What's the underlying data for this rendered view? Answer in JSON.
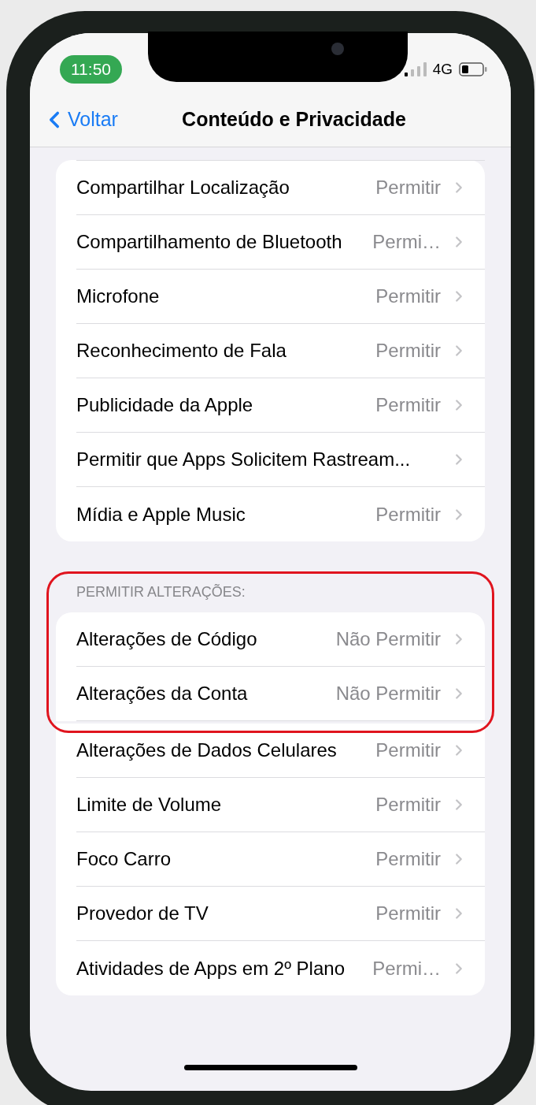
{
  "status_bar": {
    "time": "11:50",
    "network": "4G"
  },
  "nav": {
    "back": "Voltar",
    "title": "Conteúdo e Privacidade"
  },
  "sections": [
    {
      "highlighted": false,
      "rows": [
        {
          "label": "Compartilhar Localização",
          "value": "Permitir"
        },
        {
          "label": "Compartilhamento de Bluetooth",
          "value": "Permi…"
        },
        {
          "label": "Microfone",
          "value": "Permitir"
        },
        {
          "label": "Reconhecimento de Fala",
          "value": "Permitir"
        },
        {
          "label": "Publicidade da Apple",
          "value": "Permitir"
        },
        {
          "label": "Permitir que Apps Solicitem Rastream..."
        },
        {
          "label": "Mídia e Apple Music",
          "value": "Permitir"
        }
      ]
    },
    {
      "header": "PERMITIR ALTERAÇÕES:",
      "highlighted": true,
      "rows": [
        {
          "label": "Alterações de Código",
          "value": "Não Permitir"
        },
        {
          "label": "Alterações da Conta",
          "value": "Não Permitir"
        }
      ]
    },
    {
      "highlighted": false,
      "rows": [
        {
          "label": "Alterações de Dados Celulares",
          "value": "Permitir"
        },
        {
          "label": "Limite de Volume",
          "value": "Permitir"
        },
        {
          "label": "Foco Carro",
          "value": "Permitir"
        },
        {
          "label": "Provedor de TV",
          "value": "Permitir"
        },
        {
          "label": "Atividades de Apps em 2º Plano",
          "value": "Permi…"
        }
      ]
    }
  ]
}
